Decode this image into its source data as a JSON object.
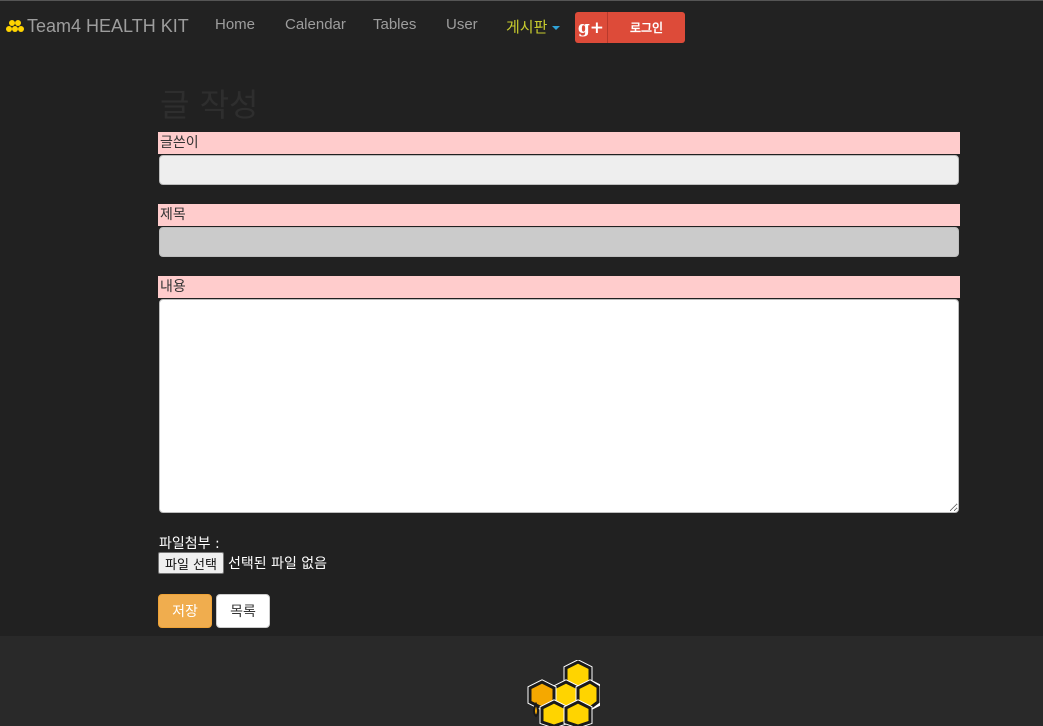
{
  "navbar": {
    "brand": "Team4 HEALTH KIT",
    "links": [
      "Home",
      "Calendar",
      "Tables",
      "User"
    ],
    "dropdown_label": "게시판",
    "google_icon": "g+",
    "login_label": "로그인"
  },
  "form": {
    "title": "글 작성",
    "writer_label": "글쓴이",
    "writer_value": "",
    "subject_label": "제목",
    "subject_value": "",
    "content_label": "내용",
    "content_value": "",
    "attach_label": "파일첨부 :",
    "file_button": "파일 선택",
    "file_status": "선택된 파일 없음",
    "save_button": "저장",
    "list_button": "목록"
  },
  "colors": {
    "accent_dropdown": "#c8cc2e",
    "google": "#dd4b39",
    "label_bg": "#ffcccc",
    "save": "#f0ad4e"
  },
  "icons": {
    "brand": "honeycomb-icon",
    "footer": "honeycomb-logo-icon"
  }
}
